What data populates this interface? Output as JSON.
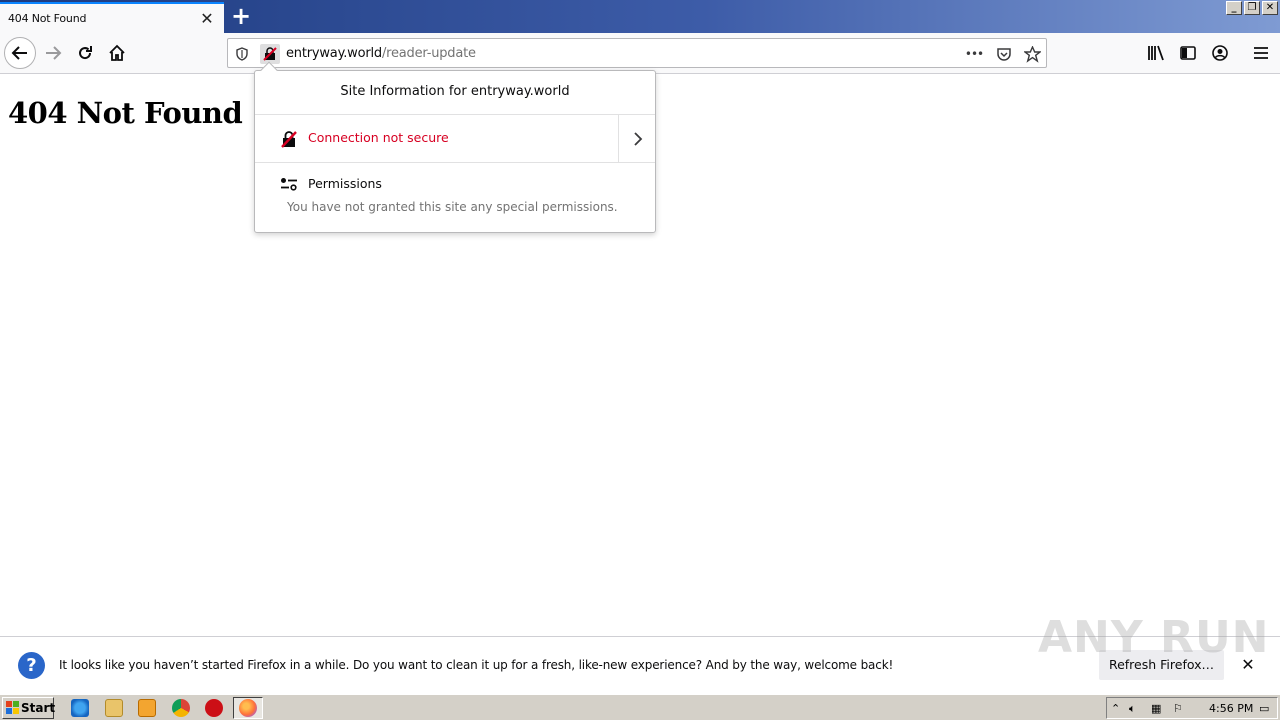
{
  "tab": {
    "title": "404 Not Found",
    "close_glyph": "✕"
  },
  "newtab_glyph": "+",
  "window_controls": {
    "minimize": "_",
    "restore": "❐",
    "close": "✕"
  },
  "urlbar": {
    "domain": "entryway.world",
    "path": "/reader-update",
    "more_glyph": "•••"
  },
  "page": {
    "heading": "404 Not Found"
  },
  "site_info": {
    "title": "Site Information for entryway.world",
    "connection": "Connection not secure",
    "permissions_title": "Permissions",
    "permissions_desc": "You have not granted this site any special permissions."
  },
  "notification": {
    "icon_glyph": "?",
    "message": "It looks like you haven’t started Firefox in a while. Do you want to clean it up for a fresh, like-new experience? And by the way, welcome back!",
    "button_label": "Refresh Firefox…",
    "close_glyph": "✕"
  },
  "watermark": "ANY RUN",
  "taskbar": {
    "start_label": "Start",
    "clock": "4:56 PM"
  },
  "colors": {
    "accent": "#0a84ff",
    "insecure": "#d70022",
    "tabstrip": "#1d3a7e"
  }
}
